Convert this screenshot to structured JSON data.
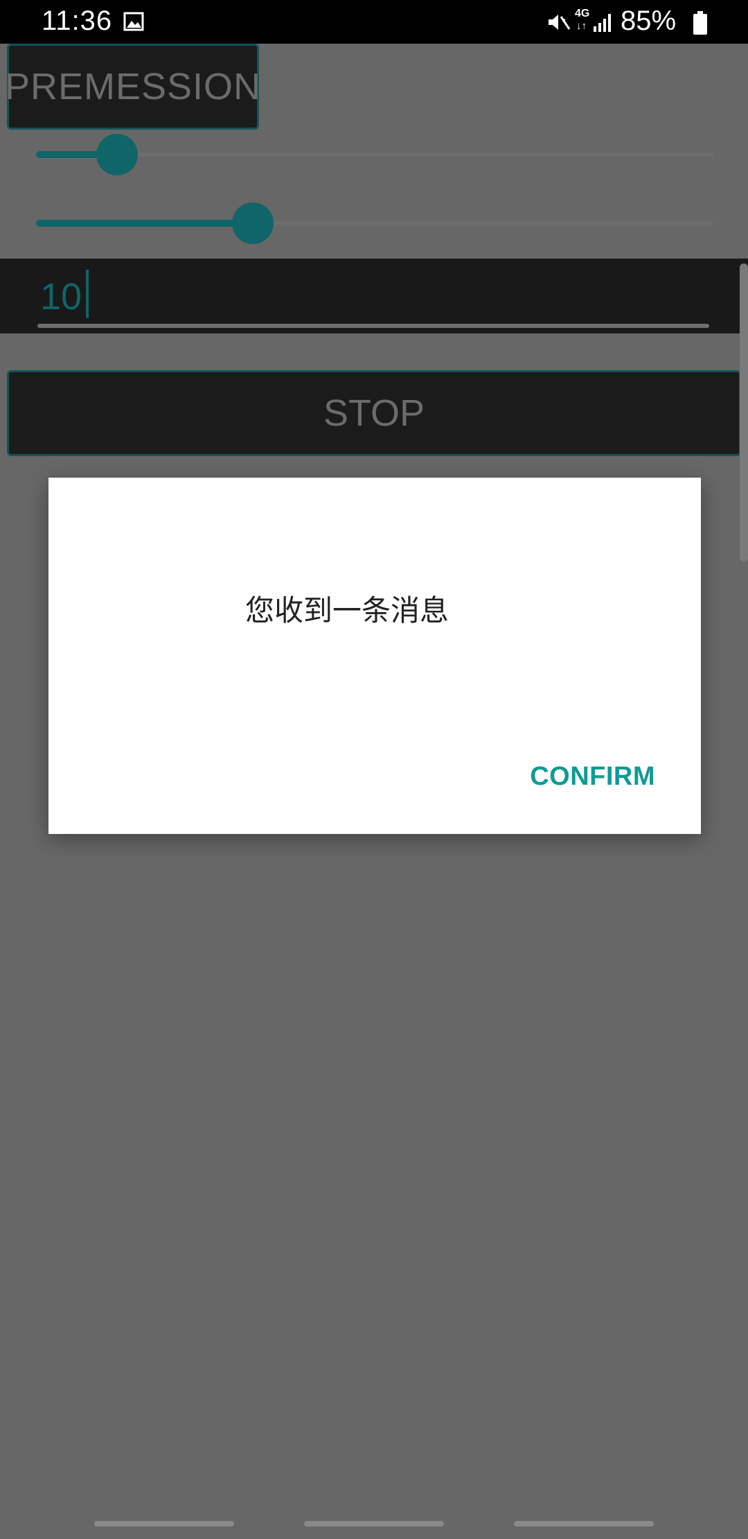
{
  "status_bar": {
    "time": "11:36",
    "network_type": "4G",
    "network_arrows": "↓↑",
    "battery_percent": "85%"
  },
  "app": {
    "permission_button_label": "PREMESSION",
    "slider1_value": 0.12,
    "slider2_value": 0.32,
    "input_value": "10",
    "stop_button_label": "STOP"
  },
  "dialog": {
    "message": "您收到一条消息",
    "confirm_label": "CONFIRM"
  },
  "colors": {
    "accent": "#0f9b94",
    "scrim": "#676767"
  }
}
